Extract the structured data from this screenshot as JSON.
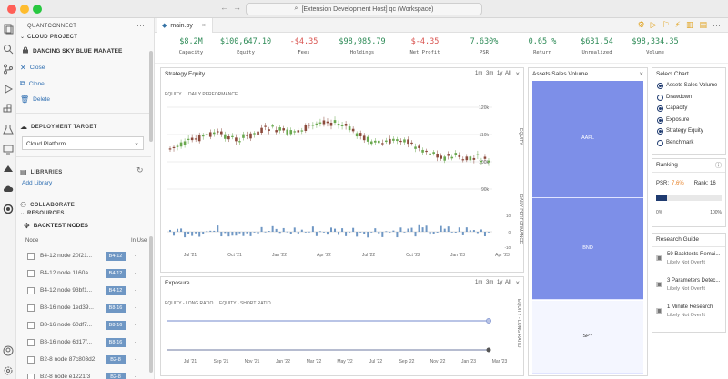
{
  "window": {
    "command_center": "[Extension Development Host] qc (Workspace)"
  },
  "sidebar": {
    "header": "QUANTCONNECT",
    "cloud_project_label": "CLOUD PROJECT",
    "project_name": "DANCING SKY BLUE MANATEE",
    "actions": [
      "Close",
      "Clone",
      "Delete"
    ],
    "deployment_label": "DEPLOYMENT TARGET",
    "deployment_value": "Cloud Platform",
    "libraries_label": "LIBRARIES",
    "add_library": "Add Library",
    "collaborate_label": "COLLABORATE",
    "resources_label": "RESOURCES",
    "backtest_nodes_label": "BACKTEST NODES",
    "node_col": "Node",
    "inuse_col": "In Use",
    "nodes": [
      {
        "name": "B4-12 node 20f21...",
        "badge": "B4-12",
        "inuse": "-"
      },
      {
        "name": "B4-12 node 1160a...",
        "badge": "B4-12",
        "inuse": "-"
      },
      {
        "name": "B4-12 node 93bf1...",
        "badge": "B4-12",
        "inuse": "-"
      },
      {
        "name": "B8-16 node 1ed39...",
        "badge": "B8-16",
        "inuse": "-"
      },
      {
        "name": "B8-16 node 60df7...",
        "badge": "B8-16",
        "inuse": "-"
      },
      {
        "name": "B8-16 node 6d17f...",
        "badge": "B8-16",
        "inuse": "-"
      },
      {
        "name": "B2-8 node 87c803d2",
        "badge": "B2-8",
        "inuse": "-"
      },
      {
        "name": "B2-8 node e1221f3",
        "badge": "B2-8",
        "inuse": "-"
      }
    ]
  },
  "tab": {
    "label": "main.py"
  },
  "stats": [
    {
      "value": "$8.2M",
      "label": "Capacity",
      "color": "#2e8b57"
    },
    {
      "value": "$100,647.10",
      "label": "Equity",
      "color": "#2e8b57"
    },
    {
      "value": "-$4.35",
      "label": "Fees",
      "color": "#d9534f"
    },
    {
      "value": "$98,985.79",
      "label": "Holdings",
      "color": "#2e8b57"
    },
    {
      "value": "$-4.35",
      "label": "Net Profit",
      "color": "#d9534f"
    },
    {
      "value": "7.630%",
      "label": "PSR",
      "color": "#2e8b57"
    },
    {
      "value": "0.65 %",
      "label": "Return",
      "color": "#2e8b57"
    },
    {
      "value": "$631.54",
      "label": "Unrealized",
      "color": "#2e8b57"
    },
    {
      "value": "$98,334.35",
      "label": "Volume",
      "color": "#2e8b57"
    }
  ],
  "strategy_panel": {
    "title": "Strategy Equity",
    "timeframes": [
      "1m",
      "3m",
      "1y",
      "All"
    ],
    "legend": [
      "EQUITY",
      "DAILY PERFORMANCE"
    ],
    "y_labels": [
      "120k",
      "110k",
      "100k",
      "90k"
    ],
    "y_axis_title": "EQUITY",
    "perf_axis_title": "DAILY PERFORMANCE",
    "perf_ticks": [
      "10",
      "0",
      "-10"
    ],
    "x_labels": [
      "Jul '21",
      "Oct '21",
      "Jan '22",
      "Apr '22",
      "Jul '22",
      "Oct '22",
      "Jan '23",
      "Apr '23"
    ]
  },
  "exposure_panel": {
    "title": "Exposure",
    "timeframes": [
      "1m",
      "3m",
      "1y",
      "All"
    ],
    "legend": [
      "EQUITY - LONG RATIO",
      "EQUITY - SHORT RATIO"
    ],
    "y_axis_title": "EQUITY - LONG RATIO",
    "x_labels": [
      "Jul '21",
      "Sep '21",
      "Nov '21",
      "Jan '22",
      "Mar '22",
      "May '22",
      "Jul '22",
      "Sep '22",
      "Nov '22",
      "Jan '23",
      "Mar '23"
    ]
  },
  "asset_panel": {
    "title": "Assets Sales Volume",
    "segments": [
      {
        "label": "AAPL",
        "share": 0.4
      },
      {
        "label": "BND",
        "share": 0.35
      },
      {
        "label": "SPY",
        "share": 0.25
      }
    ]
  },
  "select_chart": {
    "title": "Select Chart",
    "options": [
      {
        "label": "Assets Sales Volume",
        "selected": true
      },
      {
        "label": "Drawdown",
        "selected": false
      },
      {
        "label": "Capacity",
        "selected": true
      },
      {
        "label": "Exposure",
        "selected": true
      },
      {
        "label": "Strategy Equity",
        "selected": true
      },
      {
        "label": "Benchmark",
        "selected": false
      }
    ]
  },
  "ranking": {
    "title": "Ranking",
    "psr_label": "PSR:",
    "psr_value": "7.6%",
    "rank_label": "Rank: 16",
    "bar_fraction": 0.16,
    "min_label": "0%",
    "max_label": "100%"
  },
  "research": {
    "title": "Research Guide",
    "items": [
      {
        "title": "59 Backtests Remai...",
        "subtitle": "Likely Not Overfit"
      },
      {
        "title": "3 Parameters Detec...",
        "subtitle": "Likely Not Overfit"
      },
      {
        "title": "1 Minute Research",
        "subtitle": "Likely Not Overfit"
      }
    ]
  },
  "colors": {
    "up": "#6aa84f",
    "down": "#8b4a3c",
    "bar": "#6f97c4",
    "pie": "#7d8fe8",
    "pie_light": "#f4f6ff",
    "navy": "#1f3b70"
  }
}
